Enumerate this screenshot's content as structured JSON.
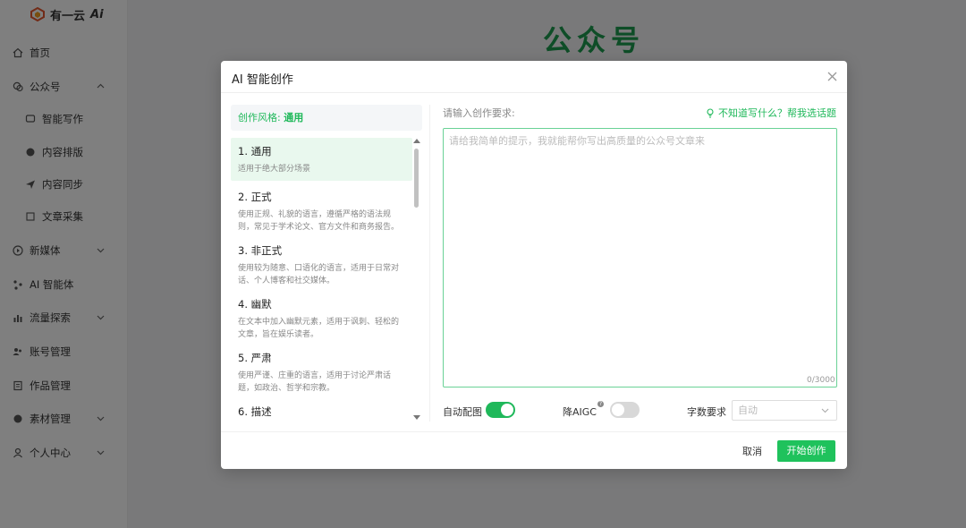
{
  "app": {
    "logo_text": "有一云",
    "page_heading": "公众号"
  },
  "sidebar": {
    "items": [
      {
        "label": "首页",
        "icon": "home-icon"
      },
      {
        "label": "公众号",
        "icon": "wechat-icon",
        "expanded": true
      },
      {
        "label": "智能写作",
        "icon": "chat-icon"
      },
      {
        "label": "内容排版",
        "icon": "palette-icon"
      },
      {
        "label": "内容同步",
        "icon": "send-icon"
      },
      {
        "label": "文章采集",
        "icon": "grid-icon"
      },
      {
        "label": "新媒体",
        "icon": "play-icon"
      },
      {
        "label": "AI 智能体",
        "icon": "ai-icon"
      },
      {
        "label": "流量探索",
        "icon": "bar-chart-icon"
      },
      {
        "label": "账号管理",
        "icon": "users-icon"
      },
      {
        "label": "作品管理",
        "icon": "document-icon"
      },
      {
        "label": "素材管理",
        "icon": "material-icon"
      },
      {
        "label": "个人中心",
        "icon": "user-icon"
      }
    ]
  },
  "modal": {
    "title": "AI 智能创作",
    "style_label": "创作风格:",
    "style_value": "通用",
    "styles": [
      {
        "title": "1. 通用",
        "desc": "适用于绝大部分场景"
      },
      {
        "title": "2. 正式",
        "desc": "使用正规、礼貌的语言，遵循严格的语法规则，常见于学术论文、官方文件和商务报告。"
      },
      {
        "title": "3. 非正式",
        "desc": "使用较为随意、口语化的语言，适用于日常对话、个人博客和社交媒体。"
      },
      {
        "title": "4. 幽默",
        "desc": "在文本中加入幽默元素，适用于讽刺、轻松的文章，旨在娱乐读者。"
      },
      {
        "title": "5. 严肃",
        "desc": "使用严谨、庄重的语言，适用于讨论严肃话题，如政治、哲学和宗教。"
      },
      {
        "title": "6. 描述",
        "desc": ""
      }
    ],
    "req_label": "请输入创作要求:",
    "help_link": "不知道写什么？帮我选话题",
    "textarea_placeholder": "请给我简单的提示，我就能帮你写出高质量的公众号文章来",
    "counter": "0/3000",
    "auto_image_label": "自动配图",
    "auto_image_on": true,
    "aigc_label": "降AIGC",
    "aigc_on": false,
    "word_count_label": "字数要求",
    "word_count_value": "自动",
    "cancel": "取消",
    "start": "开始创作"
  },
  "colors": {
    "accent": "#1fb85a",
    "heading_green": "#1c9a4e"
  }
}
